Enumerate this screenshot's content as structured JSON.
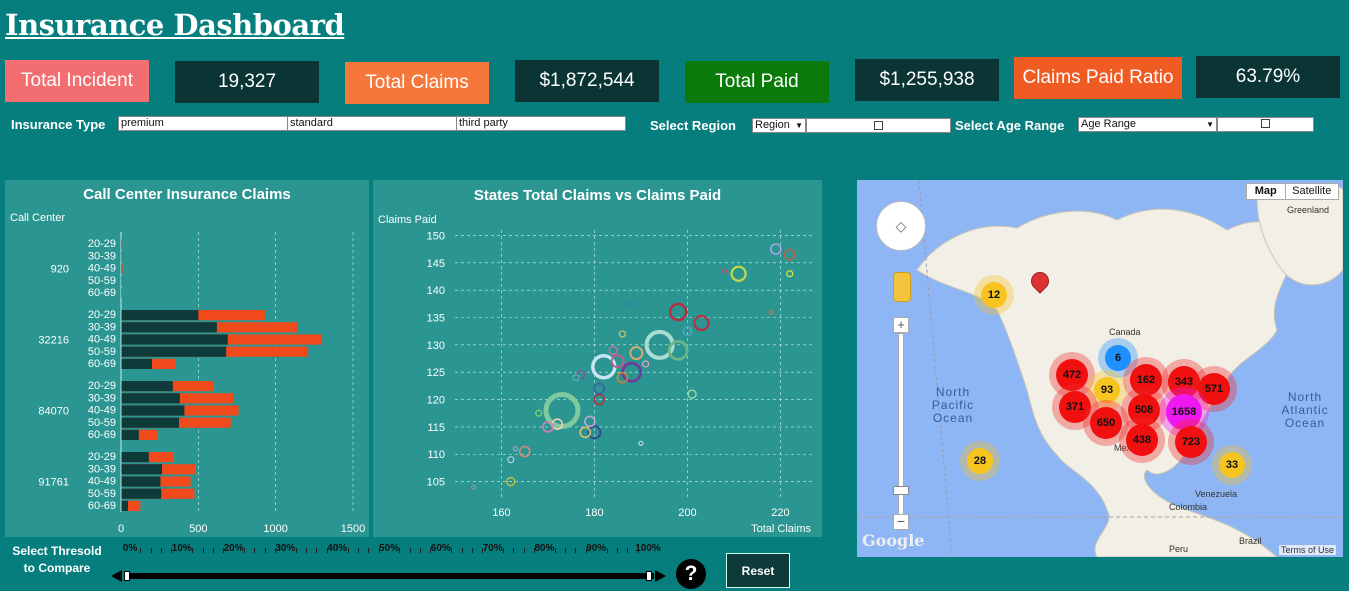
{
  "header": {
    "title": "Insurance Dashboard"
  },
  "kpis": {
    "incident_label": "Total Incident",
    "incident_value": "19,327",
    "claims_label": "Total Claims",
    "claims_value": "$1,872,544",
    "paid_label": "Total Paid",
    "paid_value": "$1,255,938",
    "ratio_label": "Claims Paid Ratio",
    "ratio_value": "63.79%"
  },
  "filters": {
    "insurance_type_label": "Insurance Type",
    "insurance_types": [
      "premium",
      "standard",
      "third party"
    ],
    "region_label": "Select Region",
    "region_value": "Region",
    "age_label": "Select Age Range",
    "age_value": "Age Range"
  },
  "colors": {
    "background": "#067e7e",
    "panel": "#2a9591",
    "bar_paid": "#0f3a3a",
    "bar_claims": "#f04a1c",
    "incident": "#f36e70",
    "claims": "#f5773a",
    "paid": "#0a7a0a",
    "ratio": "#f05a23"
  },
  "chart_data": [
    {
      "type": "bar",
      "title": "Call Center Insurance Claims",
      "ylabel": "Call Center",
      "xlim": [
        0,
        1500
      ],
      "x_ticks": [
        "0",
        "500",
        "1000",
        "1500"
      ],
      "groups": [
        {
          "name": "920",
          "rows": [
            {
              "age": "20-29",
              "paid": 3,
              "claims": 8
            },
            {
              "age": "30-39",
              "paid": 3,
              "claims": 7
            },
            {
              "age": "40-49",
              "paid": 4,
              "claims": 10
            },
            {
              "age": "50-59",
              "paid": 3,
              "claims": 6
            },
            {
              "age": "60-69",
              "paid": 2,
              "claims": 5
            }
          ]
        },
        {
          "name": "32216",
          "rows": [
            {
              "age": "20-29",
              "paid": 500,
              "claims": 930
            },
            {
              "age": "30-39",
              "paid": 620,
              "claims": 1140
            },
            {
              "age": "40-49",
              "paid": 690,
              "claims": 1300
            },
            {
              "age": "50-59",
              "paid": 680,
              "claims": 1210
            },
            {
              "age": "60-69",
              "paid": 200,
              "claims": 355
            }
          ]
        },
        {
          "name": "84070",
          "rows": [
            {
              "age": "20-29",
              "paid": 335,
              "claims": 600
            },
            {
              "age": "30-39",
              "paid": 380,
              "claims": 725
            },
            {
              "age": "40-49",
              "paid": 410,
              "claims": 760
            },
            {
              "age": "50-59",
              "paid": 375,
              "claims": 710
            },
            {
              "age": "60-69",
              "paid": 115,
              "claims": 235
            }
          ]
        },
        {
          "name": "91761",
          "rows": [
            {
              "age": "20-29",
              "paid": 180,
              "claims": 340
            },
            {
              "age": "30-39",
              "paid": 265,
              "claims": 480
            },
            {
              "age": "40-49",
              "paid": 255,
              "claims": 450
            },
            {
              "age": "50-59",
              "paid": 260,
              "claims": 475
            },
            {
              "age": "60-69",
              "paid": 45,
              "claims": 125
            }
          ]
        }
      ]
    },
    {
      "type": "scatter",
      "title": "States Total Claims vs Claims Paid",
      "xlabel": "Total Claims",
      "ylabel": "Claims Paid",
      "xlim": [
        150,
        227
      ],
      "ylim": [
        102,
        151
      ],
      "x_ticks": [
        160,
        180,
        200,
        220
      ],
      "y_ticks": [
        105,
        110,
        115,
        120,
        125,
        130,
        135,
        140,
        145,
        150
      ],
      "points": [
        {
          "x": 173,
          "y": 118,
          "r": 16,
          "c": "#7fc99e"
        },
        {
          "x": 194,
          "y": 130,
          "r": 13,
          "c": "#a9dcd2"
        },
        {
          "x": 182,
          "y": 126,
          "r": 11,
          "c": "#c9e5f2"
        },
        {
          "x": 198,
          "y": 129,
          "r": 9,
          "c": "#6db586"
        },
        {
          "x": 188,
          "y": 125,
          "r": 9,
          "c": "#6a3f9e"
        },
        {
          "x": 198,
          "y": 136,
          "r": 8,
          "c": "#b83040"
        },
        {
          "x": 203,
          "y": 134,
          "r": 7,
          "c": "#b83040"
        },
        {
          "x": 211,
          "y": 143,
          "r": 7,
          "c": "#c5d84a"
        },
        {
          "x": 180,
          "y": 114,
          "r": 6,
          "c": "#2b4e8a"
        },
        {
          "x": 185,
          "y": 127,
          "r": 6,
          "c": "#c55a8f"
        },
        {
          "x": 189,
          "y": 128.5,
          "r": 6,
          "c": "#e0a96d"
        },
        {
          "x": 181,
          "y": 120,
          "r": 5,
          "c": "#b83040"
        },
        {
          "x": 165,
          "y": 110.5,
          "r": 5,
          "c": "#d98a7a"
        },
        {
          "x": 162,
          "y": 105,
          "r": 4,
          "c": "#d6c03a"
        },
        {
          "x": 178,
          "y": 114,
          "r": 5,
          "c": "#e0c06a"
        },
        {
          "x": 172,
          "y": 115.5,
          "r": 5,
          "c": "#f1d0b8"
        },
        {
          "x": 170,
          "y": 115,
          "r": 5,
          "c": "#d77fb5"
        },
        {
          "x": 179,
          "y": 116,
          "r": 5,
          "c": "#c6a5d6"
        },
        {
          "x": 177,
          "y": 124.5,
          "r": 4,
          "c": "#8b4aa0"
        },
        {
          "x": 181,
          "y": 122,
          "r": 5,
          "c": "#3a5fa8"
        },
        {
          "x": 201,
          "y": 121,
          "r": 4,
          "c": "#a8e0a0"
        },
        {
          "x": 186,
          "y": 124,
          "r": 5,
          "c": "#d47f3a"
        },
        {
          "x": 184,
          "y": 129,
          "r": 4,
          "c": "#cf6fa0"
        },
        {
          "x": 219,
          "y": 147.5,
          "r": 5,
          "c": "#a5a8e0"
        },
        {
          "x": 222,
          "y": 146.5,
          "r": 5,
          "c": "#c0604a"
        },
        {
          "x": 222,
          "y": 143,
          "r": 3,
          "c": "#e6e83a"
        },
        {
          "x": 208,
          "y": 143.5,
          "r": 2,
          "c": "#c05070"
        },
        {
          "x": 200,
          "y": 132.5,
          "r": 4,
          "c": "#5aa6d0"
        },
        {
          "x": 168,
          "y": 117.5,
          "r": 3,
          "c": "#8ad05a"
        },
        {
          "x": 162,
          "y": 109,
          "r": 3,
          "c": "#b8d0e8"
        },
        {
          "x": 163,
          "y": 111,
          "r": 2,
          "c": "#a0a0c8"
        },
        {
          "x": 187,
          "y": 137.5,
          "r": 2,
          "c": "#3a7ab0"
        },
        {
          "x": 218,
          "y": 136,
          "r": 2,
          "c": "#d07050"
        },
        {
          "x": 190,
          "y": 112,
          "r": 2,
          "c": "#c8d8f0"
        },
        {
          "x": 176,
          "y": 124,
          "r": 3,
          "c": "#50c0a0"
        },
        {
          "x": 186,
          "y": 132,
          "r": 3,
          "c": "#e0c060"
        },
        {
          "x": 191,
          "y": 126.5,
          "r": 3,
          "c": "#f0a0c0"
        },
        {
          "x": 154,
          "y": 104,
          "r": 2,
          "c": "#9090b0"
        }
      ]
    }
  ],
  "map": {
    "type_map": "Map",
    "type_satellite": "Satellite",
    "labels": {
      "greenland": "Greenland",
      "canada": "Canada",
      "north_pacific": "North Pacific Ocean",
      "north_atlantic": "North Atlantic Ocean",
      "venezuela": "Venezuela",
      "colombia": "Colombia",
      "peru": "Peru",
      "brazil": "Brazil",
      "mexico": "Mex"
    },
    "clusters": [
      {
        "value": "12",
        "tier": "yellow"
      },
      {
        "value": "6",
        "tier": "blue"
      },
      {
        "value": "472",
        "tier": "red"
      },
      {
        "value": "93",
        "tier": "yellow"
      },
      {
        "value": "162",
        "tier": "red"
      },
      {
        "value": "343",
        "tier": "red"
      },
      {
        "value": "571",
        "tier": "red"
      },
      {
        "value": "371",
        "tier": "red"
      },
      {
        "value": "508",
        "tier": "red"
      },
      {
        "value": "1658",
        "tier": "magenta"
      },
      {
        "value": "650",
        "tier": "red"
      },
      {
        "value": "438",
        "tier": "red"
      },
      {
        "value": "723",
        "tier": "red"
      },
      {
        "value": "28",
        "tier": "yellow"
      },
      {
        "value": "33",
        "tier": "yellow"
      }
    ],
    "google": "Google",
    "terms": "Terms of Use"
  },
  "threshold": {
    "label": "Select Thresold to Compare",
    "ticks": [
      "0%",
      "10%",
      "20%",
      "30%",
      "40%",
      "50%",
      "60%",
      "70%",
      "80%",
      "90%",
      "100%"
    ],
    "help": "?",
    "reset": "Reset"
  }
}
